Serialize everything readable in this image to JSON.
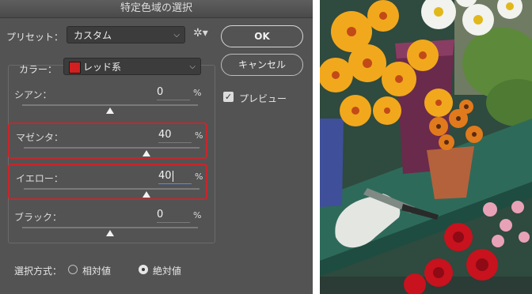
{
  "dialog": {
    "title": "特定色域の選択",
    "preset_label": "プリセット：",
    "preset_value": "カスタム",
    "color_label": "カラー：",
    "color_value": "レッド系",
    "color_swatch": "#d21f1f",
    "highlight_color": "#c8262c",
    "sliders": [
      {
        "name": "シアン：",
        "value": "0",
        "unit": "%",
        "level_percent": 0,
        "highlighted": false
      },
      {
        "name": "マゼンタ：",
        "value": "40",
        "unit": "%",
        "level_percent": 40,
        "highlighted": true
      },
      {
        "name": "イエロー：",
        "value": "40",
        "unit": "%",
        "level_percent": 40,
        "highlighted": true
      },
      {
        "name": "ブラック：",
        "value": "0",
        "unit": "%",
        "level_percent": 0,
        "highlighted": false
      }
    ],
    "method_label": "選択方式：",
    "method_relative": "相対値",
    "method_absolute": "絶対値",
    "method_selected": "absolute",
    "buttons": {
      "ok": "OK",
      "cancel": "キャンセル"
    },
    "preview_label": "プレビュー",
    "preview_checked": true
  },
  "photo": {
    "description_icon": "flower-photo"
  }
}
